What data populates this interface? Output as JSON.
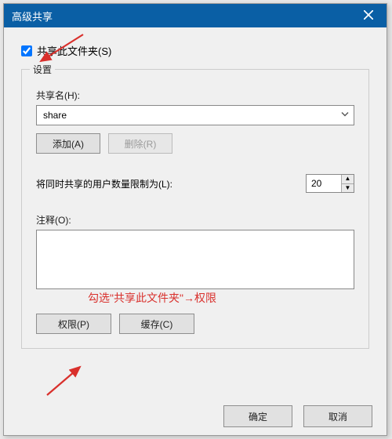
{
  "title": "高级共享",
  "share_checkbox_label": "共享此文件夹(S)",
  "share_checkbox_checked": true,
  "settings_legend": "设置",
  "share_name_label": "共享名(H):",
  "share_name_value": "share",
  "add_button": "添加(A)",
  "remove_button": "删除(R)",
  "limit_label": "将同时共享的用户数量限制为(L):",
  "limit_value": "20",
  "comment_label": "注释(O):",
  "comment_value": "",
  "permissions_button": "权限(P)",
  "cache_button": "缓存(C)",
  "ok_button": "确定",
  "cancel_button": "取消",
  "annotation_text": "勾选\"共享此文件夹\"→权限"
}
